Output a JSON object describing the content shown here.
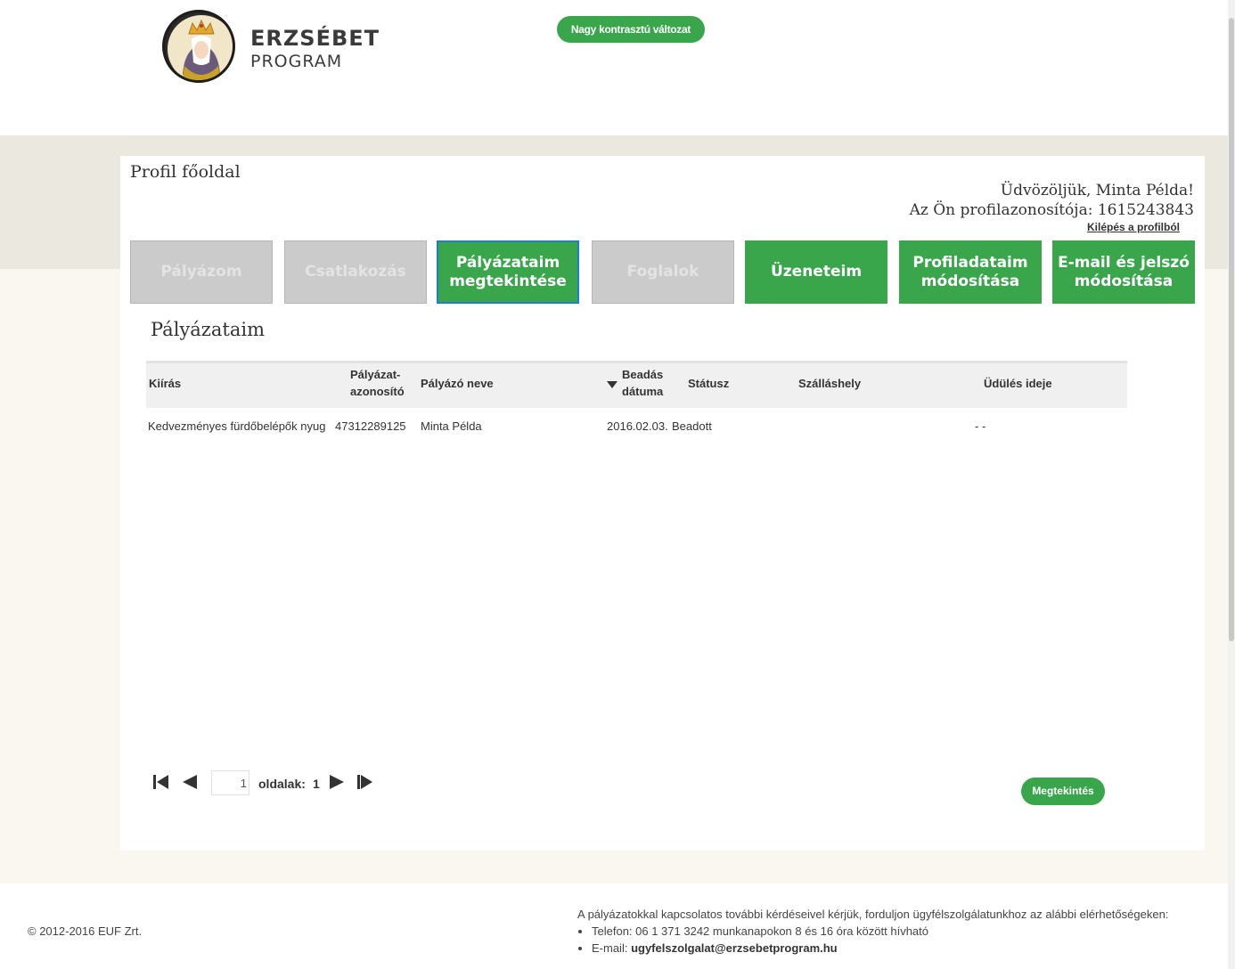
{
  "header": {
    "logo_line1": "ERZSÉBET",
    "logo_line2": "PROGRAM",
    "contrast_button": "Nagy kontrasztú változat"
  },
  "profile": {
    "page_title": "Profil főoldal",
    "welcome": "Üdvözöljük, Minta Példa!",
    "profile_id_label": "Az Ön profilazonosítója: 1615243843",
    "logout": "Kilépés a profilból"
  },
  "tabs": [
    {
      "label": "Pályázom",
      "state": "disabled"
    },
    {
      "label": "Csatlakozás",
      "state": "disabled"
    },
    {
      "label": "Pályázataim megtekintése",
      "state": "active"
    },
    {
      "label": "Foglalok",
      "state": "disabled"
    },
    {
      "label": "Üzeneteim",
      "state": "enabled"
    },
    {
      "label": "Profiladataim módosítása",
      "state": "enabled"
    },
    {
      "label": "E-mail és jelszó módosítása",
      "state": "enabled"
    }
  ],
  "section_title": "Pályázataim",
  "table": {
    "columns": {
      "kiiras": "Kiírás",
      "azonosito_1": "Pályázat-",
      "azonosito_2": "azonosító",
      "nev": "Pályázó neve",
      "datum_1": "Beadás",
      "datum_2": "dátuma",
      "statusz": "Státusz",
      "szallashely": "Szálláshely",
      "udules": "Üdülés ideje"
    },
    "rows": [
      {
        "kiiras": "Kedvezményes fürdőbelépők nyug",
        "azonosito": "47312289125",
        "nev": "Minta Példa",
        "datum": "2016.02.03.",
        "statusz": "Beadott",
        "szallashely": "",
        "udules": "- -"
      }
    ]
  },
  "pager": {
    "page_value": "1",
    "label": "oldalak:",
    "count": "1"
  },
  "view_button": "Megtekintés",
  "footer": {
    "copyright": "© 2012-2016 EUF Zrt.",
    "contact_intro": "A pályázatokkal kapcsolatos további kérdéseivel kérjük, forduljon ügyfélszolgálatunkhoz az alábbi elérhetőségeken:",
    "phone": "Telefon: 06 1 371 3242 munkanapokon 8 és 16 óra között hívható",
    "email_label": "E-mail: ",
    "email": "ugyfelszolgalat@erzsebetprogram.hu"
  },
  "colors": {
    "accent_green": "#3aa64c",
    "disabled_grey": "#cbcbcb",
    "active_border": "#1e7fd1"
  }
}
